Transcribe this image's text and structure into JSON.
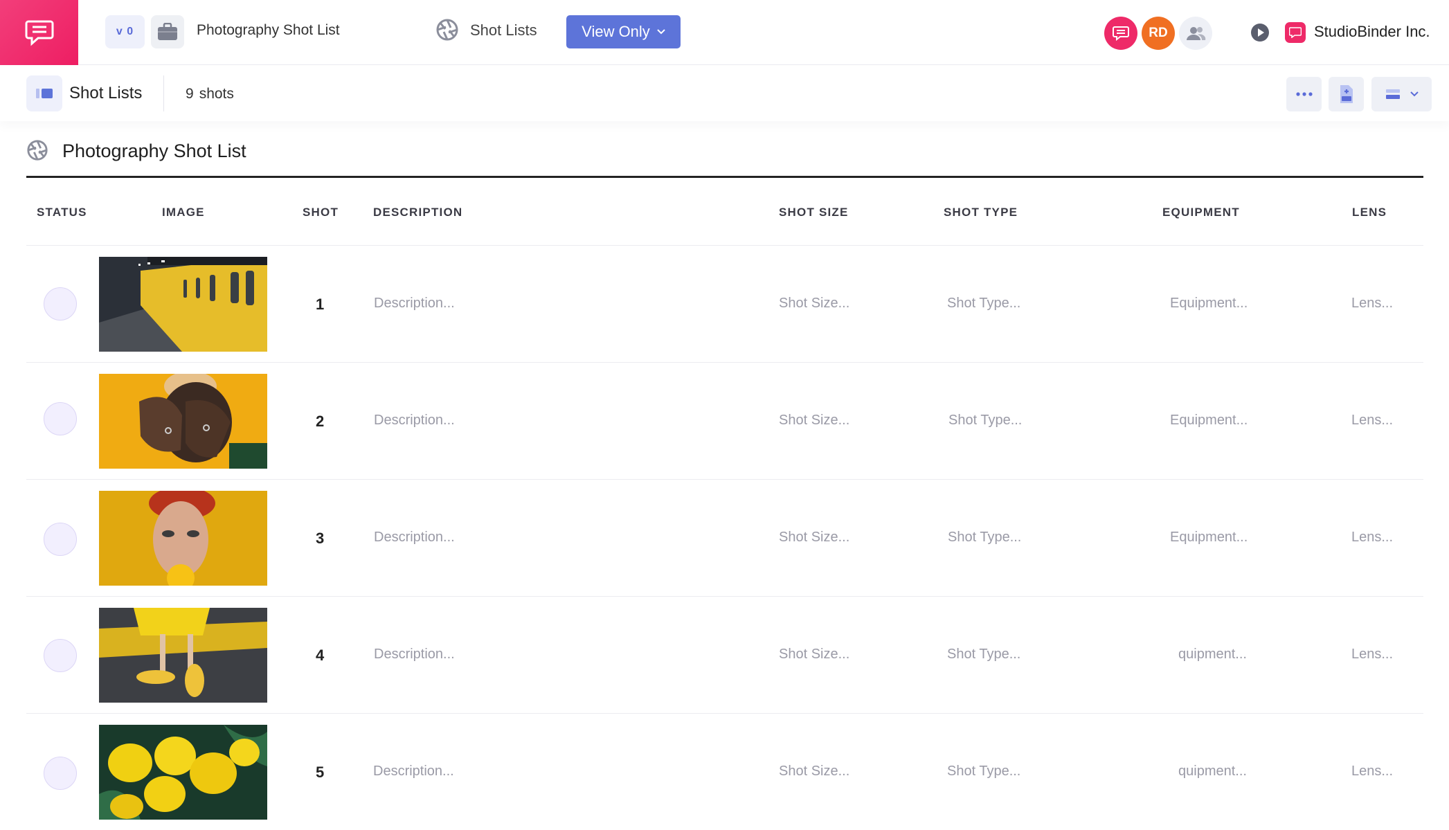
{
  "header": {
    "version": "v 0",
    "project_name": "Photography Shot List",
    "tool_name": "Shot Lists",
    "view_mode": "View Only",
    "avatars": [
      {
        "initials": "",
        "color": "#ee2a68",
        "icon": "chat-bubble-icon"
      },
      {
        "initials": "RD",
        "color": "#f06f22"
      },
      {
        "initials": "",
        "color": "#eef0f6",
        "icon": "people-icon"
      }
    ],
    "company_name": "StudioBinder Inc."
  },
  "subbar": {
    "title": "Shot Lists",
    "shot_count": "9",
    "shot_unit": "shots"
  },
  "list": {
    "title": "Photography Shot List",
    "columns": {
      "status": "STATUS",
      "image": "IMAGE",
      "shot": "SHOT",
      "description": "DESCRIPTION",
      "shot_size": "SHOT SIZE",
      "shot_type": "SHOT TYPE",
      "equipment": "EQUIPMENT",
      "lens": "LENS"
    },
    "rows": [
      {
        "shot": "1",
        "image": "subway-train",
        "description": "Description...",
        "shot_size": "Shot Size...",
        "shot_type": "Shot Type...",
        "equipment": "Equipment...",
        "lens": "Lens..."
      },
      {
        "shot": "2",
        "image": "hands-over-face",
        "description": "Description...",
        "shot_size": "Shot Size...",
        "shot_type": "Shot Type...",
        "equipment": "Equipment...",
        "lens": "Lens..."
      },
      {
        "shot": "3",
        "image": "woman-lemon",
        "description": "Description...",
        "shot_size": "Shot Size...",
        "shot_type": "Shot Type...",
        "equipment": "Equipment...",
        "lens": "Lens..."
      },
      {
        "shot": "4",
        "image": "yellow-sneakers",
        "description": "Description...",
        "shot_size": "Shot Size...",
        "shot_type": "Shot Type...",
        "equipment": "quipment...",
        "lens": "Lens..."
      },
      {
        "shot": "5",
        "image": "lemons",
        "description": "Description...",
        "shot_size": "Shot Size...",
        "shot_type": "Shot Type...",
        "equipment": "quipment...",
        "lens": "Lens..."
      }
    ]
  },
  "colors": {
    "brand": "#ee2a68",
    "accent": "#5d74d9",
    "status_fill": "#f2effe"
  }
}
